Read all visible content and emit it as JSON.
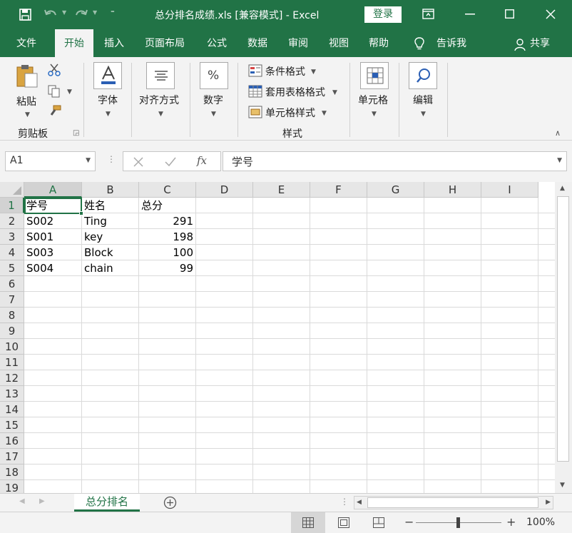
{
  "titlebar": {
    "title": "总分排名成绩.xls  [兼容模式]  -  Excel",
    "login_label": "登录"
  },
  "tabs": [
    "文件",
    "开始",
    "插入",
    "页面布局",
    "公式",
    "数据",
    "审阅",
    "视图",
    "帮助"
  ],
  "tell_me": "告诉我",
  "share": "共享",
  "ribbon": {
    "paste": "粘贴",
    "clipboard_group": "剪贴板",
    "font": "字体",
    "align": "对齐方式",
    "number": "数字",
    "cond_format": "条件格式",
    "table_format": "套用表格格式",
    "cell_style": "单元格样式",
    "styles_group": "样式",
    "cells": "单元格",
    "editing": "编辑"
  },
  "formula_bar": {
    "name_box": "A1",
    "fx": "fx",
    "value": "学号"
  },
  "columns": [
    "A",
    "B",
    "C",
    "D",
    "E",
    "F",
    "G",
    "H",
    "I"
  ],
  "rows": [
    "1",
    "2",
    "3",
    "4",
    "5",
    "6",
    "7",
    "8",
    "9",
    "10",
    "11",
    "12",
    "13",
    "14",
    "15",
    "16",
    "17",
    "18",
    "19"
  ],
  "cells": [
    [
      "学号",
      "姓名",
      "总分"
    ],
    [
      "S002",
      "Ting",
      "291"
    ],
    [
      "S001",
      "key",
      "198"
    ],
    [
      "S003",
      "Block",
      "100"
    ],
    [
      "S004",
      "chain",
      "99"
    ]
  ],
  "sheet_tab": "总分排名",
  "status": {
    "zoom": "100%"
  },
  "colors": {
    "brand": "#217346"
  }
}
